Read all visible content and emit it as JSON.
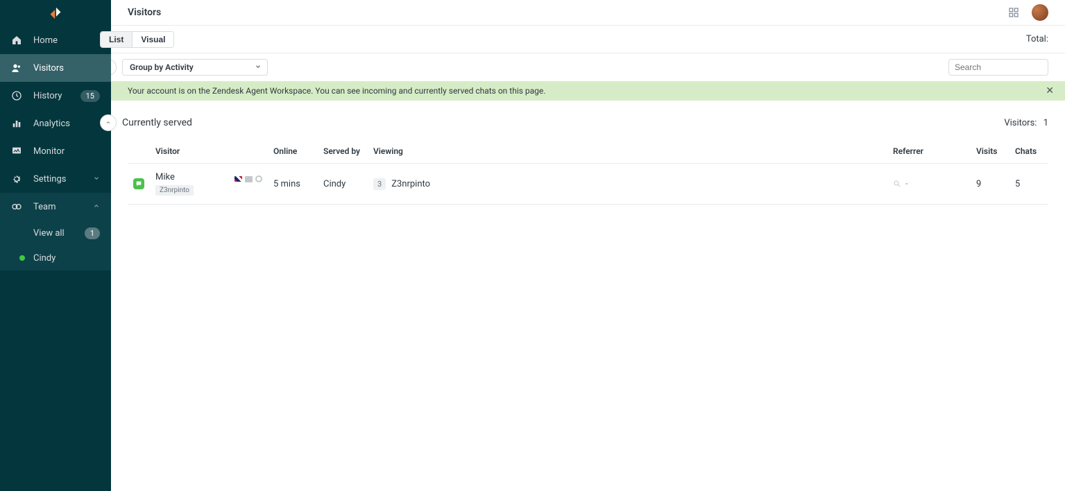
{
  "sidebar": {
    "items": [
      {
        "label": "Home"
      },
      {
        "label": "Visitors"
      },
      {
        "label": "History",
        "badge": "15"
      },
      {
        "label": "Analytics"
      },
      {
        "label": "Monitor"
      },
      {
        "label": "Settings"
      },
      {
        "label": "Team"
      }
    ],
    "team_sub": {
      "view_all": {
        "label": "View all",
        "badge": "1"
      },
      "members": [
        {
          "label": "Cindy"
        }
      ]
    }
  },
  "header": {
    "title": "Visitors"
  },
  "controls": {
    "tabs": {
      "list": "List",
      "visual": "Visual"
    },
    "total_label": "Total:"
  },
  "filter": {
    "group_label": "Group by Activity",
    "search_placeholder": "Search"
  },
  "banner": {
    "text": "Your account is on the Zendesk Agent Workspace. You can see incoming and currently served chats on this page."
  },
  "section": {
    "title": "Currently served",
    "visitors_label": "Visitors:",
    "visitors_count": "1"
  },
  "table": {
    "headers": {
      "visitor": "Visitor",
      "online": "Online",
      "served_by": "Served by",
      "viewing": "Viewing",
      "referrer": "Referrer",
      "visits": "Visits",
      "chats": "Chats"
    },
    "rows": [
      {
        "name": "Mike",
        "tag": "Z3nrpinto",
        "online": "5 mins",
        "served_by": "Cindy",
        "viewing_count": "3",
        "viewing_page": "Z3nrpinto",
        "referrer": "-",
        "visits": "9",
        "chats": "5"
      }
    ]
  }
}
